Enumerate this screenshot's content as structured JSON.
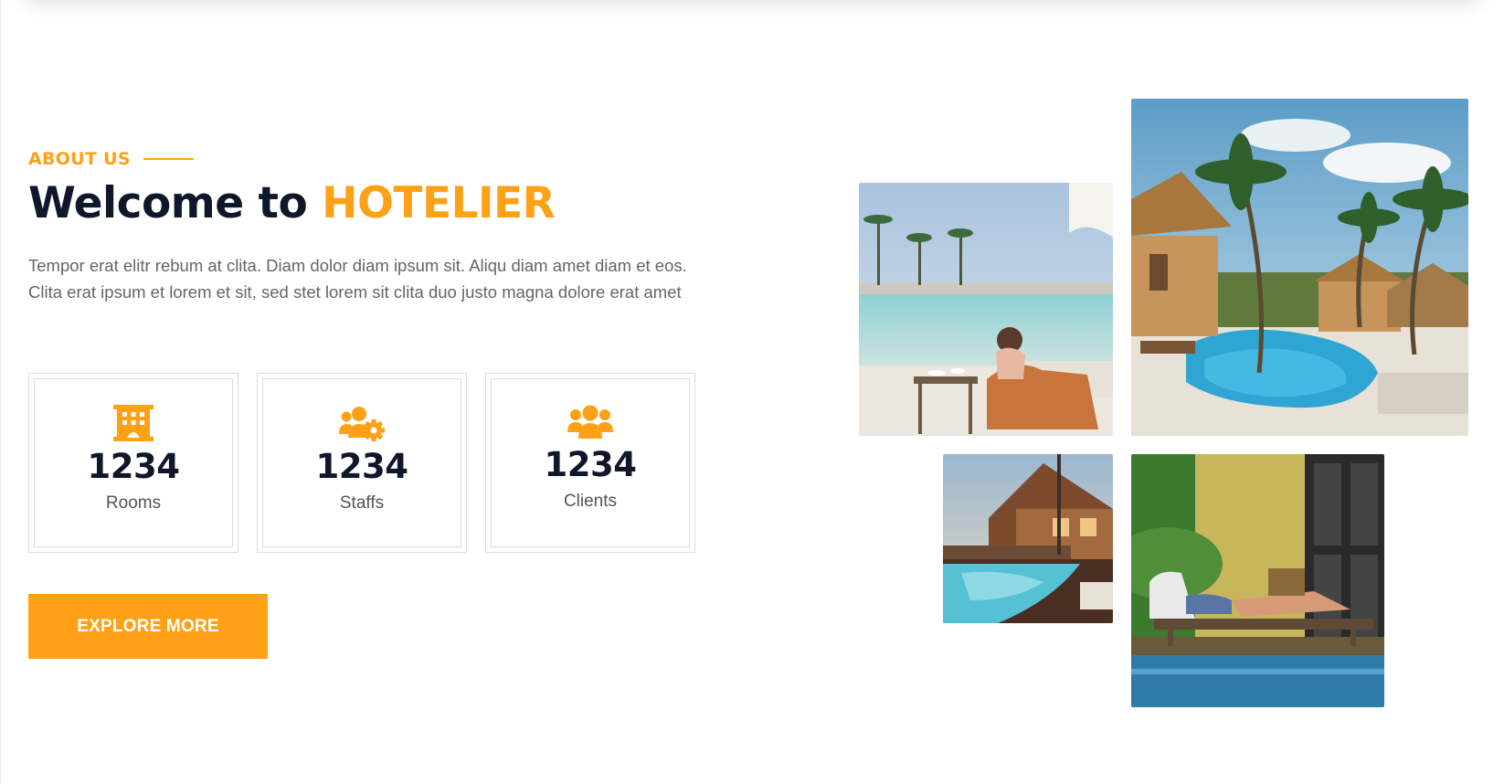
{
  "about": {
    "label": "ABOUT US",
    "title_prefix": "Welcome to ",
    "title_brand": "HOTELIER",
    "description": "Tempor erat elitr rebum at clita. Diam dolor diam ipsum sit. Aliqu diam amet diam et eos. Clita erat ipsum et lorem et sit, sed stet lorem sit clita duo justo magna dolore erat amet"
  },
  "stats": [
    {
      "icon": "hotel-icon",
      "number": "1234",
      "label": "Rooms"
    },
    {
      "icon": "users-cog-icon",
      "number": "1234",
      "label": "Staffs"
    },
    {
      "icon": "users-icon",
      "number": "1234",
      "label": "Clients"
    }
  ],
  "cta": {
    "label": "EXPLORE MORE"
  },
  "photos": [
    {
      "name": "pool-lounge-photo"
    },
    {
      "name": "tropical-pool-photo"
    },
    {
      "name": "pool-deck-photo"
    },
    {
      "name": "sunbather-photo"
    }
  ],
  "colors": {
    "accent": "#fea116",
    "dark": "#0f172b",
    "text": "#666565"
  }
}
